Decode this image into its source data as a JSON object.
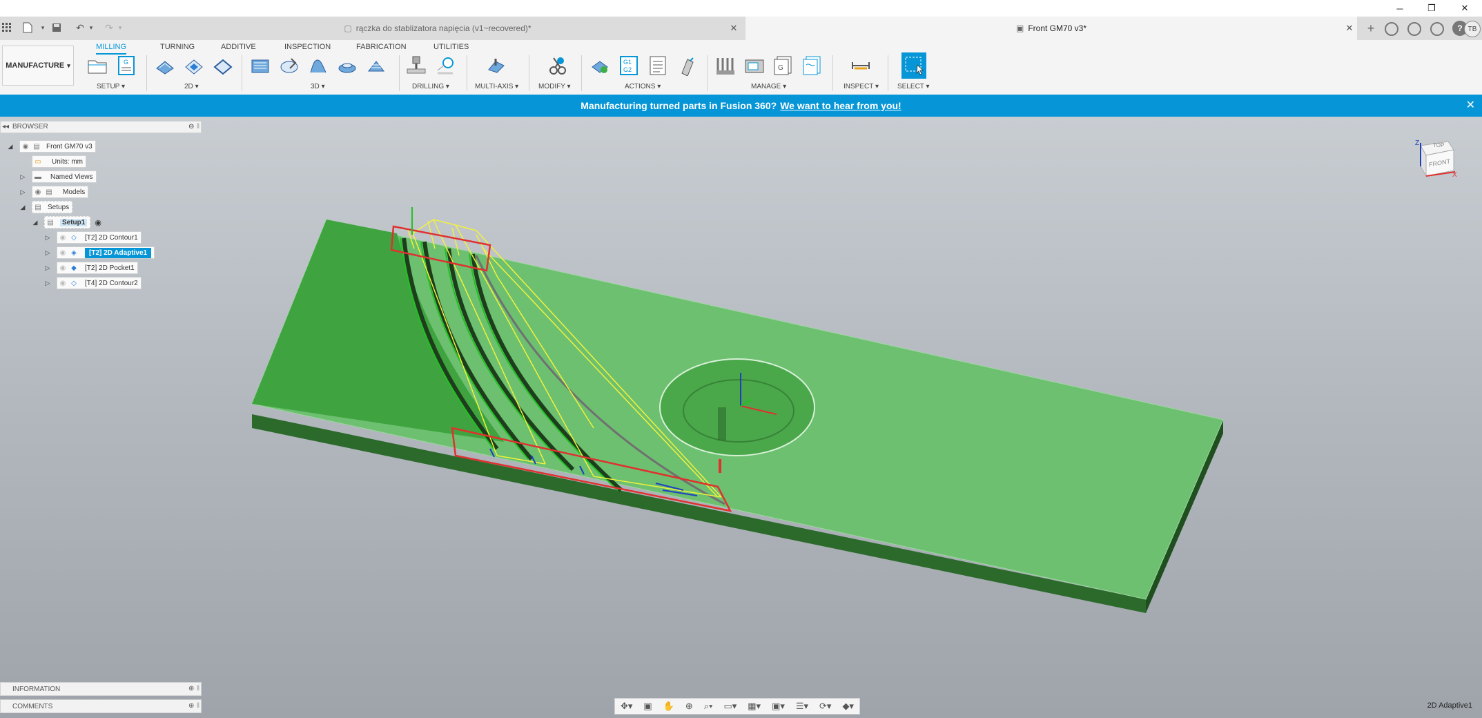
{
  "window": {
    "minimize_label": "─",
    "restore_label": "❐",
    "close_label": "✕"
  },
  "quickbar": {
    "apps_icon": "grid-icon",
    "file_icon": "file-icon",
    "save_icon": "save-icon",
    "undo_icon": "undo-icon",
    "redo_icon": "redo-icon"
  },
  "tabs": [
    {
      "label": "rączka do stablizatora napięcia (v1~recovered)*",
      "active": false
    },
    {
      "label": "Front GM70 v3*",
      "active": true
    }
  ],
  "workspace": {
    "label": "MANUFACTURE"
  },
  "ribbon_tabs": [
    "MILLING",
    "TURNING",
    "ADDITIVE",
    "INSPECTION",
    "FABRICATION",
    "UTILITIES"
  ],
  "ribbon_groups": [
    "SETUP",
    "2D",
    "3D",
    "DRILLING",
    "MULTI-AXIS",
    "MODIFY",
    "ACTIONS",
    "MANAGE",
    "INSPECT",
    "SELECT"
  ],
  "banner": {
    "text": "Manufacturing turned parts in Fusion 360?",
    "link": "We want to hear from you!",
    "close": "✕"
  },
  "browser": {
    "title": "BROWSER",
    "root": "Front GM70 v3",
    "units": "Units: mm",
    "named_views": "Named Views",
    "models": "Models",
    "setups": "Setups",
    "setup1": "Setup1",
    "operations": [
      {
        "label": "[T2] 2D Contour1",
        "selected": false
      },
      {
        "label": "[T2] 2D Adaptive1",
        "selected": true
      },
      {
        "label": "[T2] 2D Pocket1",
        "selected": false
      },
      {
        "label": "[T4] 2D Contour2",
        "selected": false
      }
    ]
  },
  "viewcube": {
    "top": "TOP",
    "front": "FRONT",
    "x_axis": "X",
    "z_axis": "Z"
  },
  "panels": {
    "information": "INFORMATION",
    "comments": "COMMENTS"
  },
  "status": {
    "selection": "2D Adaptive1"
  },
  "avatar": "TB",
  "colors": {
    "accent": "#0696d7",
    "stock_top": "#6cc070",
    "stock_side": "#2e6b2e",
    "toolpath": "#f2f23a",
    "boundary": "#e03030"
  }
}
